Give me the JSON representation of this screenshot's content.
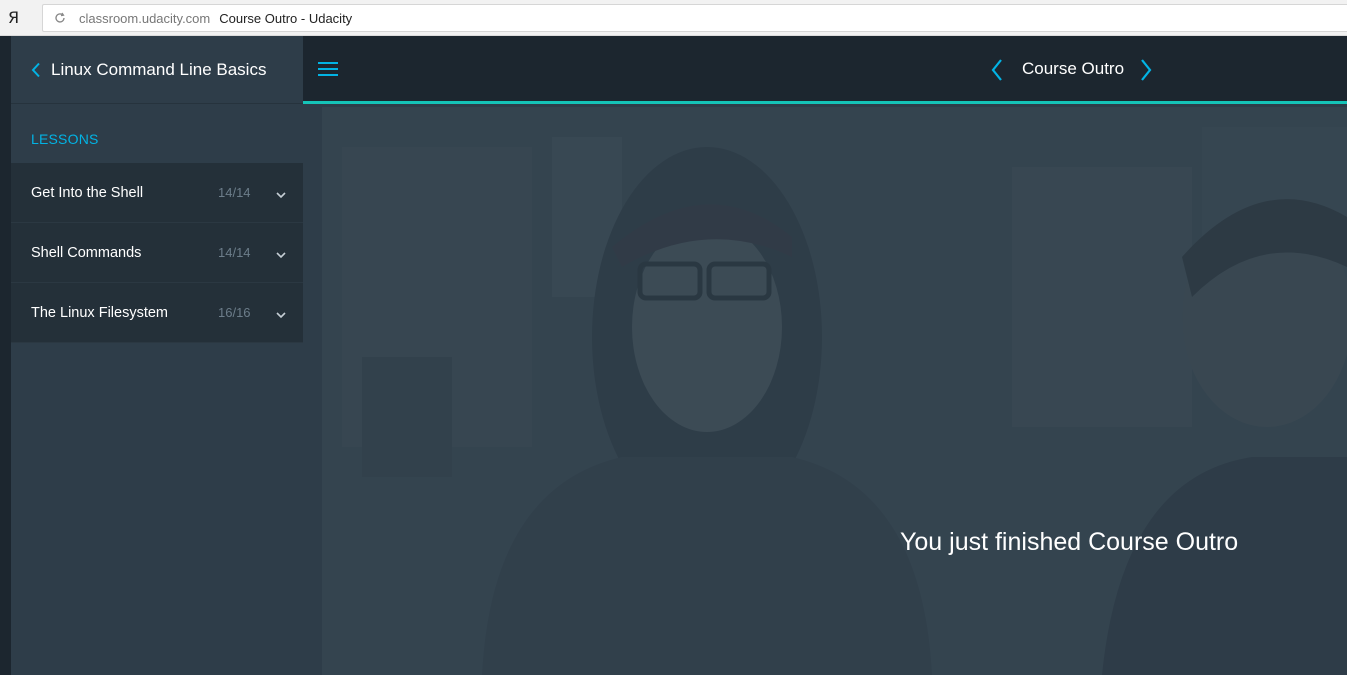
{
  "browser": {
    "logo_letter": "Я",
    "url_domain": "classroom.udacity.com",
    "page_title": "Course Outro - Udacity"
  },
  "sidebar": {
    "course_title": "Linux Command Line Basics",
    "lessons_heading": "LESSONS",
    "lessons": [
      {
        "title": "Get Into the Shell",
        "progress": "14/14"
      },
      {
        "title": "Shell Commands",
        "progress": "14/14"
      },
      {
        "title": "The Linux Filesystem",
        "progress": "16/16"
      }
    ]
  },
  "header": {
    "concept_title": "Course Outro"
  },
  "video": {
    "finished_message": "You just finished Course Outro"
  },
  "colors": {
    "accent": "#02b3e4",
    "progress_line": "#15c4b8",
    "sidebar_bg": "#2e3d49",
    "topbar_bg": "#1c262f"
  }
}
